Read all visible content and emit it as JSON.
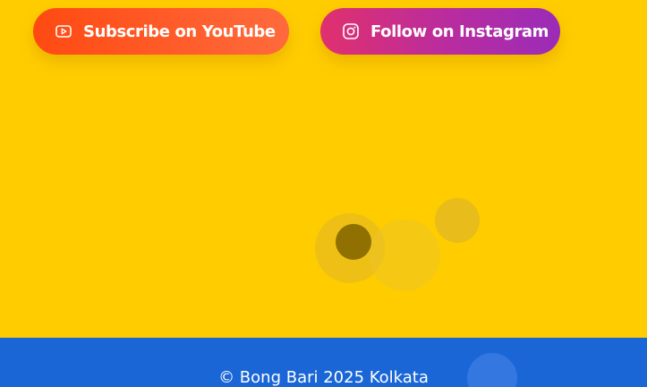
{
  "buttons": {
    "youtube": {
      "label": "Subscribe on YouTube",
      "icon": "youtube-icon",
      "gradient": [
        "#ff4a12",
        "#ff6a3c"
      ]
    },
    "instagram": {
      "label": "Follow on Instagram",
      "icon": "instagram-icon",
      "gradient": [
        "#e0306e",
        "#9a2cb8"
      ]
    }
  },
  "footer": {
    "copyright": "© Bong Bari 2025 Kolkata"
  },
  "colors": {
    "background": "#ffcc00",
    "footer": "#1a66d6",
    "text": "#ffffff"
  }
}
